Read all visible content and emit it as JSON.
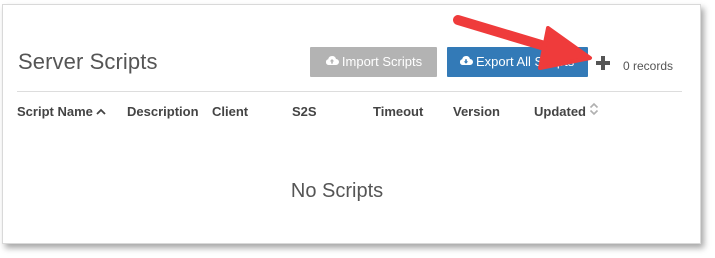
{
  "header": {
    "title": "Server Scripts",
    "import_label": "Import Scripts",
    "export_label": "Export All Scripts",
    "records_text": "0 records"
  },
  "table": {
    "columns": [
      "Script Name",
      "Description",
      "Client",
      "S2S",
      "Timeout",
      "Version",
      "Updated"
    ]
  },
  "empty_state": {
    "message": "No Scripts"
  },
  "colors": {
    "import_button": "#b3b3b3",
    "export_button": "#337ab7",
    "annotation_arrow": "#ef3b3b"
  },
  "icons": {
    "import": "cloud-upload-icon",
    "export": "cloud-download-icon",
    "add": "plus-icon",
    "sort_asc": "chevron-up-icon",
    "sort_both": "sort-icon",
    "annotation": "arrow-icon"
  }
}
